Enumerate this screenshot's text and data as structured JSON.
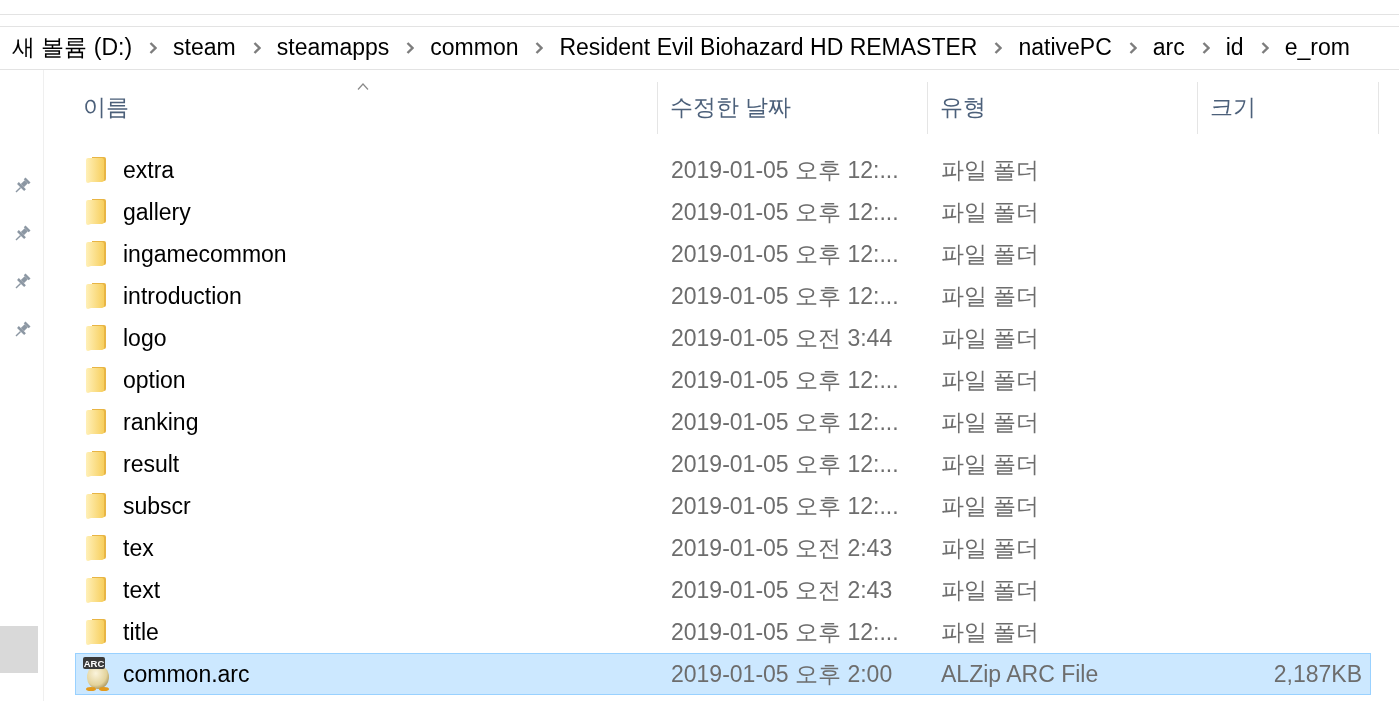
{
  "breadcrumb": [
    "새 볼륨 (D:)",
    "steam",
    "steamapps",
    "common",
    "Resident Evil Biohazard HD REMASTER",
    "nativePC",
    "arc",
    "id",
    "e_rom"
  ],
  "columns": [
    {
      "label": "이름",
      "sorted": true
    },
    {
      "label": "수정한 날짜",
      "sorted": false
    },
    {
      "label": "유형",
      "sorted": false
    },
    {
      "label": "크기",
      "sorted": false
    }
  ],
  "rows": [
    {
      "kind": "folder",
      "name": "extra",
      "date": "2019-01-05 오후 12:...",
      "type": "파일 폴더",
      "selected": false
    },
    {
      "kind": "folder",
      "name": "gallery",
      "date": "2019-01-05 오후 12:...",
      "type": "파일 폴더",
      "selected": false
    },
    {
      "kind": "folder",
      "name": "ingamecommon",
      "date": "2019-01-05 오후 12:...",
      "type": "파일 폴더",
      "selected": false
    },
    {
      "kind": "folder",
      "name": "introduction",
      "date": "2019-01-05 오후 12:...",
      "type": "파일 폴더",
      "selected": false
    },
    {
      "kind": "folder",
      "name": "logo",
      "date": "2019-01-05 오전 3:44",
      "type": "파일 폴더",
      "selected": false
    },
    {
      "kind": "folder",
      "name": "option",
      "date": "2019-01-05 오후 12:...",
      "type": "파일 폴더",
      "selected": false
    },
    {
      "kind": "folder",
      "name": "ranking",
      "date": "2019-01-05 오후 12:...",
      "type": "파일 폴더",
      "selected": false
    },
    {
      "kind": "folder",
      "name": "result",
      "date": "2019-01-05 오후 12:...",
      "type": "파일 폴더",
      "selected": false
    },
    {
      "kind": "folder",
      "name": "subscr",
      "date": "2019-01-05 오후 12:...",
      "type": "파일 폴더",
      "selected": false
    },
    {
      "kind": "folder",
      "name": "tex",
      "date": "2019-01-05 오전 2:43",
      "type": "파일 폴더",
      "selected": false
    },
    {
      "kind": "folder",
      "name": "text",
      "date": "2019-01-05 오전 2:43",
      "type": "파일 폴더",
      "selected": false
    },
    {
      "kind": "folder",
      "name": "title",
      "date": "2019-01-05 오후 12:...",
      "type": "파일 폴더",
      "selected": false
    },
    {
      "kind": "archive",
      "badge": "ARC",
      "name": "common.arc",
      "date": "2019-01-05 오후 2:00",
      "type": "ALZip ARC File",
      "size": "2,187KB",
      "selected": true
    }
  ]
}
